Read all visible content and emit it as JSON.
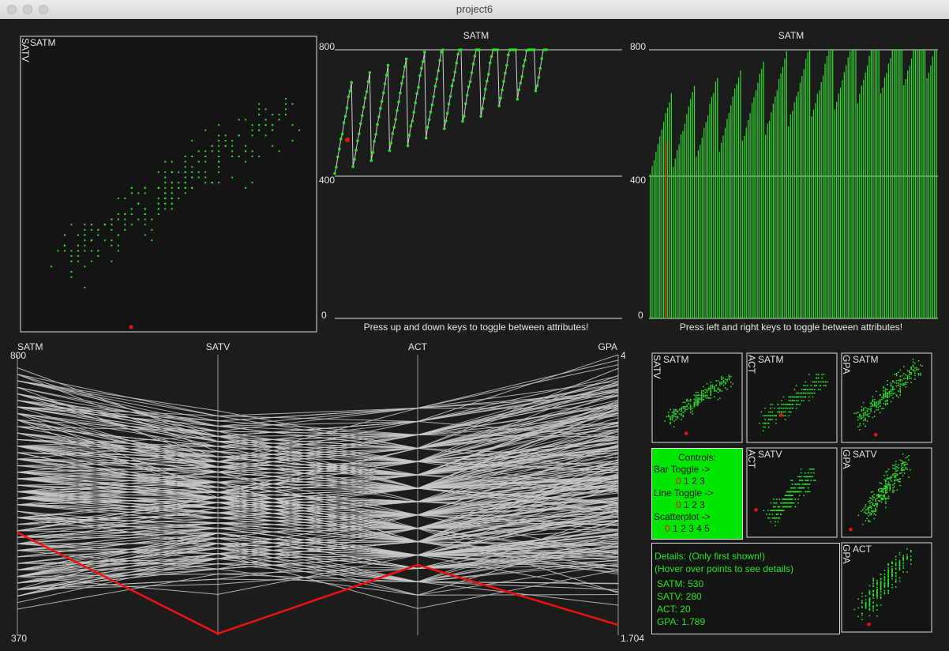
{
  "window": {
    "title": "project6"
  },
  "scatter_main": {
    "x_label": "SATM",
    "y_label": "SATV"
  },
  "line_chart": {
    "title": "SATM",
    "y_max_label": "800",
    "y_mid_label": "400",
    "y_min_label": "0",
    "hint": "Press up and down keys to toggle between attributes!"
  },
  "bar_chart": {
    "title": "SATM",
    "y_max_label": "800",
    "y_mid_label": "400",
    "y_min_label": "0",
    "hint": "Press left and right keys to toggle between attributes!"
  },
  "parallel": {
    "axes": [
      "SATM",
      "SATV",
      "ACT",
      "GPA"
    ],
    "left_max": "800",
    "left_min": "370",
    "right_max": "4",
    "right_min": "1.704"
  },
  "matrix": {
    "cells": [
      {
        "x": "SATM",
        "y": "SATV"
      },
      {
        "x": "SATM",
        "y": "ACT"
      },
      {
        "x": "SATM",
        "y": "GPA"
      },
      {
        "x": "SATV",
        "y": "ACT"
      },
      {
        "x": "SATV",
        "y": "GPA"
      },
      {
        "x": "ACT",
        "y": "GPA"
      }
    ]
  },
  "controls": {
    "title": "Controls:",
    "bar_label": "Bar Toggle ->",
    "bar_options": [
      "0",
      "1",
      "2",
      "3"
    ],
    "line_label": "Line Toggle ->",
    "line_options": [
      "0",
      "1",
      "2",
      "3"
    ],
    "scatter_label": "Scatterplot ->",
    "scatter_options": [
      "0",
      "1",
      "2",
      "3",
      "4",
      "5"
    ]
  },
  "details": {
    "heading": "Details:  (Only first shown!)",
    "hint": "(Hover over points to see details)",
    "satm": "SATM: 530",
    "satv": "SATV: 280",
    "act": "ACT: 20",
    "gpa": "GPA: 1.789"
  },
  "selected_record": {
    "SATM": 530,
    "SATV": 280,
    "ACT": 20,
    "GPA": 1.789
  },
  "colors": {
    "point": "#2ee02e",
    "highlight": "#ee1111",
    "background": "#1c1c1c",
    "lines": "#c8c8c8",
    "controls_bg": "#00e600"
  }
}
